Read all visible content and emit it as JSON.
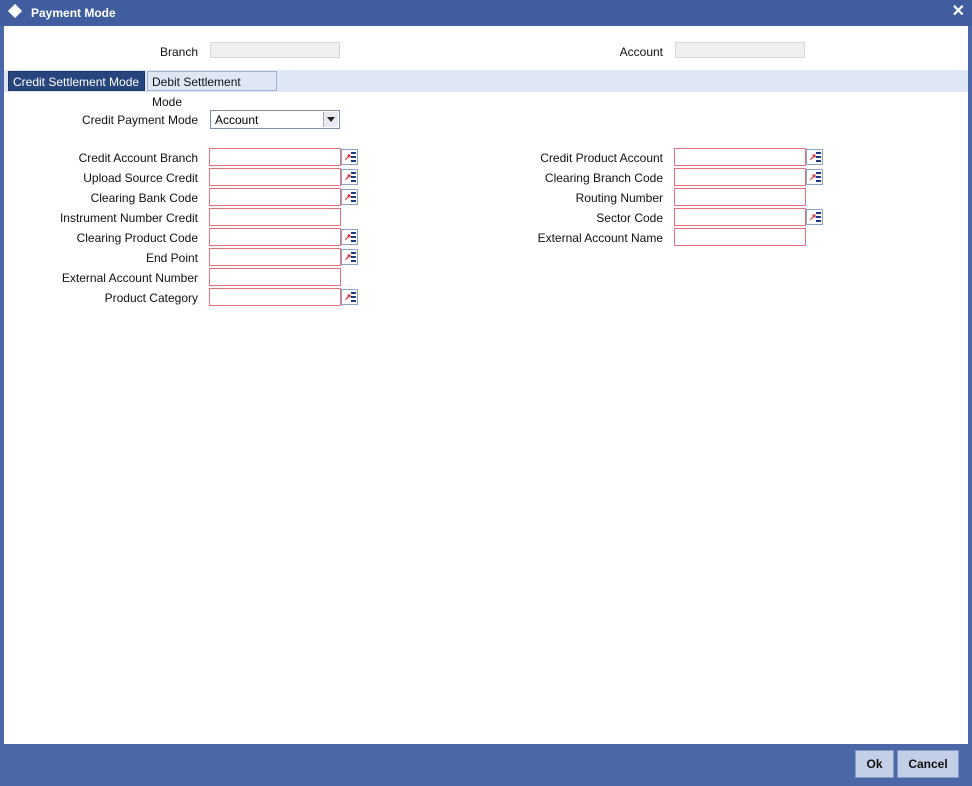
{
  "window": {
    "title": "Payment Mode",
    "icon": "diamond-icon",
    "close_label": "✕"
  },
  "header": {
    "branch_label": "Branch",
    "branch_value": "",
    "account_label": "Account",
    "account_value": ""
  },
  "tabs": [
    {
      "label": "Credit Settlement Mode",
      "active": true
    },
    {
      "label": "Debit Settlement Mode",
      "active": false
    }
  ],
  "credit_payment_mode": {
    "label": "Credit Payment Mode",
    "value": "Account"
  },
  "left_fields": [
    {
      "label": "Credit Account Branch",
      "value": "",
      "lov": true
    },
    {
      "label": "Upload Source Credit",
      "value": "",
      "lov": true
    },
    {
      "label": "Clearing Bank Code",
      "value": "",
      "lov": true
    },
    {
      "label": "Instrument Number Credit",
      "value": "",
      "lov": false
    },
    {
      "label": "Clearing Product Code",
      "value": "",
      "lov": true
    },
    {
      "label": "End Point",
      "value": "",
      "lov": true
    },
    {
      "label": "External Account Number",
      "value": "",
      "lov": false
    },
    {
      "label": "Product Category",
      "value": "",
      "lov": true
    }
  ],
  "right_fields": [
    {
      "label": "Credit Product Account",
      "value": "",
      "lov": true
    },
    {
      "label": "Clearing Branch Code",
      "value": "",
      "lov": true
    },
    {
      "label": "Routing Number",
      "value": "",
      "lov": false
    },
    {
      "label": "Sector Code",
      "value": "",
      "lov": true
    },
    {
      "label": "External Account Name",
      "value": "",
      "lov": false
    }
  ],
  "footer": {
    "ok_label": "Ok",
    "cancel_label": "Cancel"
  },
  "colors": {
    "titlebar": "#3f5d9f",
    "active_tab": "#27457c",
    "mandatory_border": "#e6707a",
    "footer": "#4a67a8"
  }
}
